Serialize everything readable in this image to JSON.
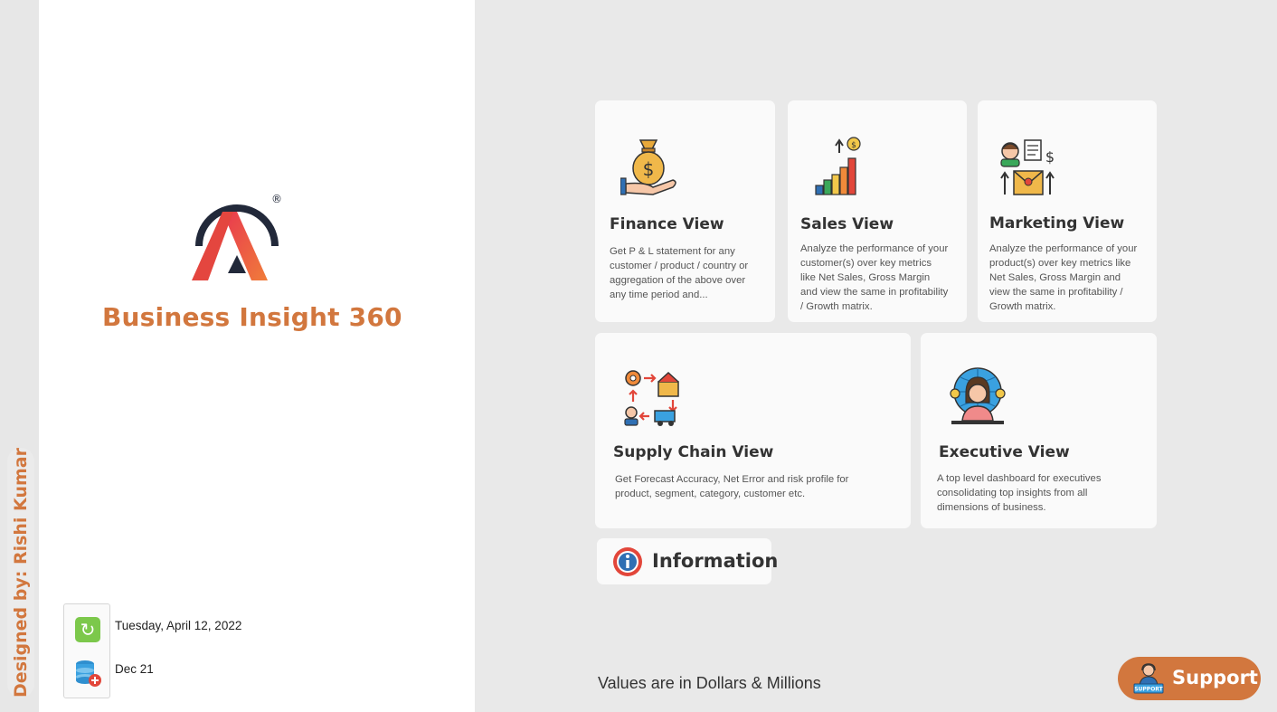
{
  "sidebar": {
    "designer_text": "Designed by: Rishi Kumar"
  },
  "brand": {
    "title": "Business Insight 360",
    "registered_mark": "®",
    "accent_color": "#d2773e"
  },
  "status": {
    "last_refresh": "Tuesday, April 12, 2022",
    "data_period": "Dec 21"
  },
  "cards": [
    {
      "title": "Finance View",
      "description": "Get P & L statement for any customer / product / country or aggregation of the above over any time period and...",
      "icon": "money-bag-icon"
    },
    {
      "title": "Sales View",
      "description": "Analyze the performance of your customer(s) over key metrics like Net Sales, Gross Margin and view the same in profitability / Growth matrix.",
      "icon": "growth-bar-chart-icon"
    },
    {
      "title": "Marketing View",
      "description": "Analyze the performance of your product(s) over key metrics like Net Sales, Gross Margin and view the same in profitability / Growth matrix.",
      "icon": "marketing-icon"
    },
    {
      "title": "Supply Chain View",
      "description": "Get Forecast Accuracy, Net Error and risk profile for product, segment, category, customer etc.",
      "icon": "supply-chain-icon"
    },
    {
      "title": "Executive View",
      "description": "A top level dashboard for executives consolidating top insights from all dimensions of business.",
      "icon": "executive-icon"
    }
  ],
  "info_button": {
    "label": "Information",
    "icon": "info-icon"
  },
  "footer": {
    "values_note": "Values are in Dollars & Millions"
  },
  "support_button": {
    "label": "Support",
    "icon_badge": "SUPPORT"
  }
}
